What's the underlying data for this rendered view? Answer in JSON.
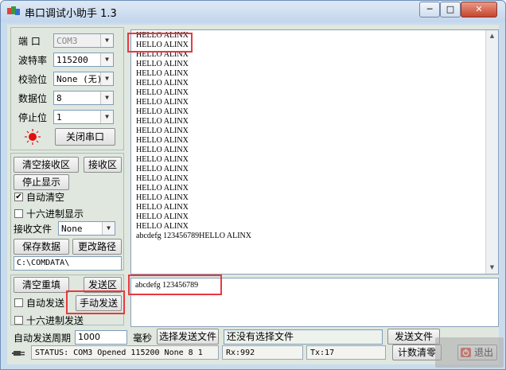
{
  "window": {
    "title": "串口调试小助手 1.3",
    "min": "─",
    "max": "□",
    "close": "✕"
  },
  "left_panel": {
    "port": {
      "label": "端 口",
      "value": "COM3"
    },
    "baud": {
      "label": "波特率",
      "value": "115200"
    },
    "parity": {
      "label": "校验位",
      "value": "None (无)"
    },
    "databits": {
      "label": "数据位",
      "value": "8"
    },
    "stopbits": {
      "label": "停止位",
      "value": "1"
    },
    "close_port_button": "关闭串口",
    "clear_rx_button": "清空接收区",
    "rx_area_button": "接收区",
    "stop_display_button": "停止显示",
    "auto_clear": {
      "label": "自动清空",
      "checked": true
    },
    "hex_display": {
      "label": "十六进制显示",
      "checked": false
    },
    "rx_file": {
      "label": "接收文件",
      "value": "None"
    },
    "save_data_button": "保存数据",
    "change_path_button": "更改路径",
    "path": "C:\\COMDATA\\"
  },
  "rx": {
    "lines": [
      "HELLO ALINX",
      "HELLO ALINX",
      "HELLO ALINX",
      "HELLO ALINX",
      "HELLO ALINX",
      "HELLO ALINX",
      "HELLO ALINX",
      "HELLO ALINX",
      "HELLO ALINX",
      "HELLO ALINX",
      "HELLO ALINX",
      "HELLO ALINX",
      "HELLO ALINX",
      "HELLO ALINX",
      "HELLO ALINX",
      "HELLO ALINX",
      "HELLO ALINX",
      "HELLO ALINX",
      "HELLO ALINX",
      "HELLO ALINX",
      "HELLO ALINX",
      "abcdefg 123456789HELLO ALINX"
    ]
  },
  "tx": {
    "clear_resend_button": "清空重填",
    "send_area_button": "发送区",
    "auto_send": {
      "label": "自动发送",
      "checked": false
    },
    "manual_send_button": "手动发送",
    "hex_send": {
      "label": "十六进制发送",
      "checked": false
    },
    "text": "abcdefg 123456789",
    "period_label": "自动发送周期",
    "period_value": "1000",
    "ms_label": "毫秒",
    "select_file_button": "选择发送文件",
    "no_file_text": "还没有选择文件",
    "send_file_button": "发送文件",
    "count_clear_button": "计数清零",
    "exit_button": "退出"
  },
  "status": {
    "text": "STATUS: COM3 Opened 115200 None  8 1",
    "rx": "Rx:992",
    "tx": "Tx:17"
  },
  "colors": {
    "highlight": "#e8393e",
    "indicator": "#e01010"
  }
}
